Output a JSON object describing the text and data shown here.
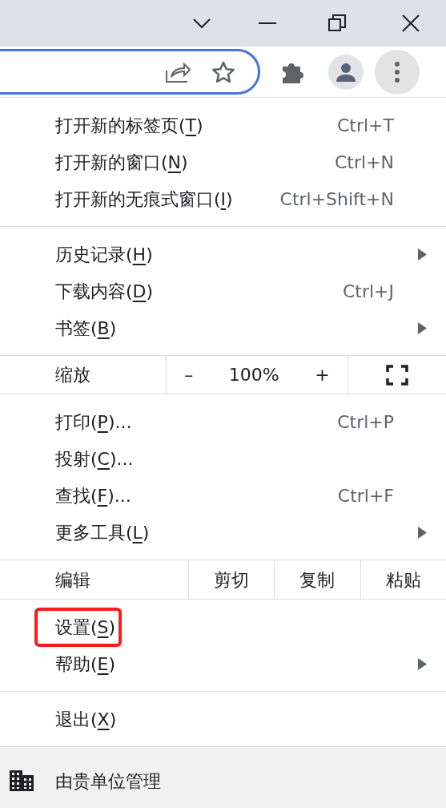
{
  "menu": {
    "sections": [
      {
        "kind": "items",
        "items": [
          {
            "label": {
              "before": "打开新的标签页(",
              "key": "T",
              "after": ")"
            },
            "shortcut": "Ctrl+T",
            "submenu": false,
            "highlighted": false
          },
          {
            "label": {
              "before": "打开新的窗口(",
              "key": "N",
              "after": ")"
            },
            "shortcut": "Ctrl+N",
            "submenu": false,
            "highlighted": false
          },
          {
            "label": {
              "before": "打开新的无痕式窗口(",
              "key": "I",
              "after": ")"
            },
            "shortcut": "Ctrl+Shift+N",
            "submenu": false,
            "highlighted": false
          }
        ]
      },
      {
        "kind": "items",
        "items": [
          {
            "label": {
              "before": "历史记录(",
              "key": "H",
              "after": ")"
            },
            "submenu": true,
            "highlighted": false
          },
          {
            "label": {
              "before": "下载内容(",
              "key": "D",
              "after": ")"
            },
            "shortcut": "Ctrl+J",
            "submenu": false,
            "highlighted": false
          },
          {
            "label": {
              "before": "书签(",
              "key": "B",
              "after": ")"
            },
            "submenu": true,
            "highlighted": false
          }
        ]
      },
      {
        "kind": "zoom",
        "label": "缩放",
        "minus": "–",
        "value": "100%",
        "plus": "+"
      },
      {
        "kind": "items",
        "items": [
          {
            "label": {
              "before": "打印(",
              "key": "P",
              "after": ")..."
            },
            "shortcut": "Ctrl+P",
            "submenu": false,
            "highlighted": false
          },
          {
            "label": {
              "before": "投射(",
              "key": "C",
              "after": ")..."
            },
            "submenu": false,
            "highlighted": false
          },
          {
            "label": {
              "before": "查找(",
              "key": "F",
              "after": ")..."
            },
            "shortcut": "Ctrl+F",
            "submenu": false,
            "highlighted": false
          },
          {
            "label": {
              "before": "更多工具(",
              "key": "L",
              "after": ")"
            },
            "submenu": true,
            "highlighted": false
          }
        ]
      },
      {
        "kind": "edit",
        "label": "编辑",
        "actions": [
          "剪切",
          "复制",
          "粘贴"
        ]
      },
      {
        "kind": "items",
        "items": [
          {
            "label": {
              "before": "设置(",
              "key": "S",
              "after": ")"
            },
            "submenu": false,
            "highlighted": true
          },
          {
            "label": {
              "before": "帮助(",
              "key": "E",
              "after": ")"
            },
            "submenu": true,
            "highlighted": false
          }
        ]
      },
      {
        "kind": "items",
        "items": [
          {
            "label": {
              "before": "退出(",
              "key": "X",
              "after": ")"
            },
            "submenu": false,
            "highlighted": false
          }
        ]
      },
      {
        "kind": "managed",
        "label": "由贵单位管理"
      }
    ]
  }
}
